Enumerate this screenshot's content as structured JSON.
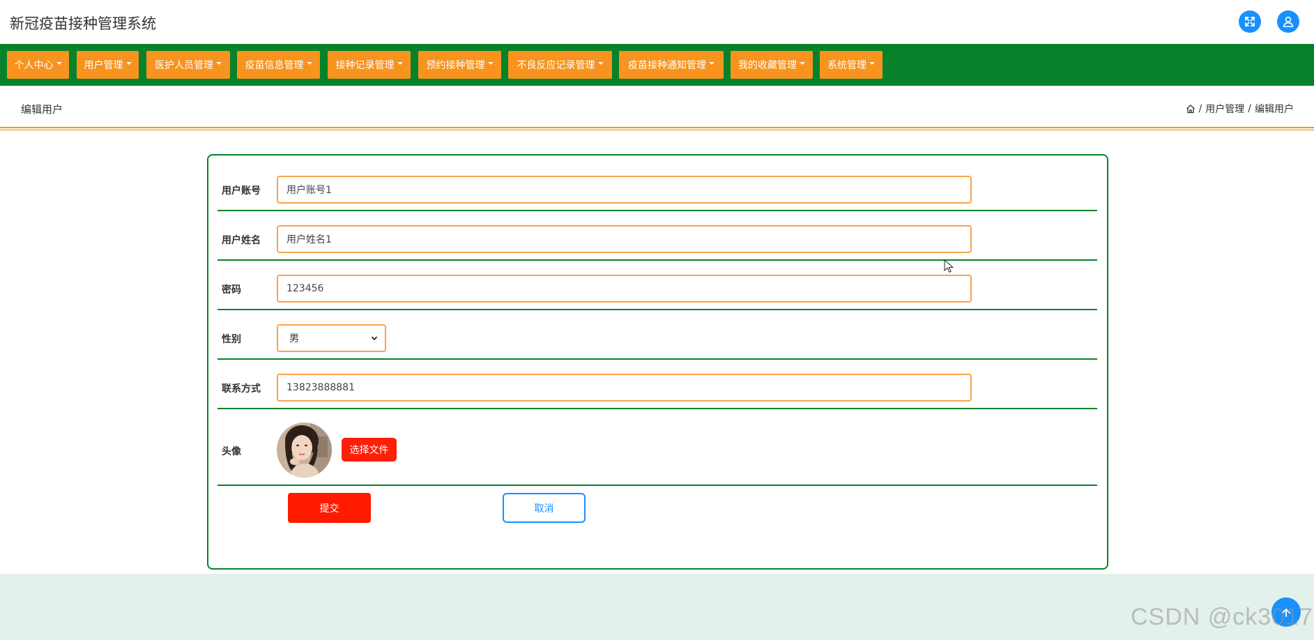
{
  "app": {
    "title": "新冠疫苗接种管理系统"
  },
  "header_icons": [
    "fullscreen-icon",
    "user-icon"
  ],
  "nav": {
    "items": [
      {
        "label": "个人中心"
      },
      {
        "label": "用户管理"
      },
      {
        "label": "医护人员管理"
      },
      {
        "label": "疫苗信息管理"
      },
      {
        "label": "接种记录管理"
      },
      {
        "label": "预约接种管理"
      },
      {
        "label": "不良反应记录管理"
      },
      {
        "label": "疫苗接种通知管理"
      },
      {
        "label": "我的收藏管理"
      },
      {
        "label": "系统管理"
      }
    ]
  },
  "page": {
    "title": "编辑用户"
  },
  "breadcrumb": {
    "separator": "/",
    "items": [
      "用户管理",
      "编辑用户"
    ]
  },
  "form": {
    "account": {
      "label": "用户账号",
      "value": "用户账号1"
    },
    "name": {
      "label": "用户姓名",
      "value": "用户姓名1"
    },
    "password": {
      "label": "密码",
      "value": "123456"
    },
    "gender": {
      "label": "性别",
      "value": "男"
    },
    "phone": {
      "label": "联系方式",
      "value": "13823888881"
    },
    "avatar": {
      "label": "头像",
      "button_label": "选择文件"
    },
    "submit_label": "提交",
    "cancel_label": "取消"
  },
  "watermark": "CSDN @ck3017",
  "colors": {
    "nav_bg": "#05822a",
    "nav_item": "#f7931e",
    "accent_blue": "#1890ff",
    "submit_red": "#ff1a00",
    "input_border": "#f7a54a"
  }
}
